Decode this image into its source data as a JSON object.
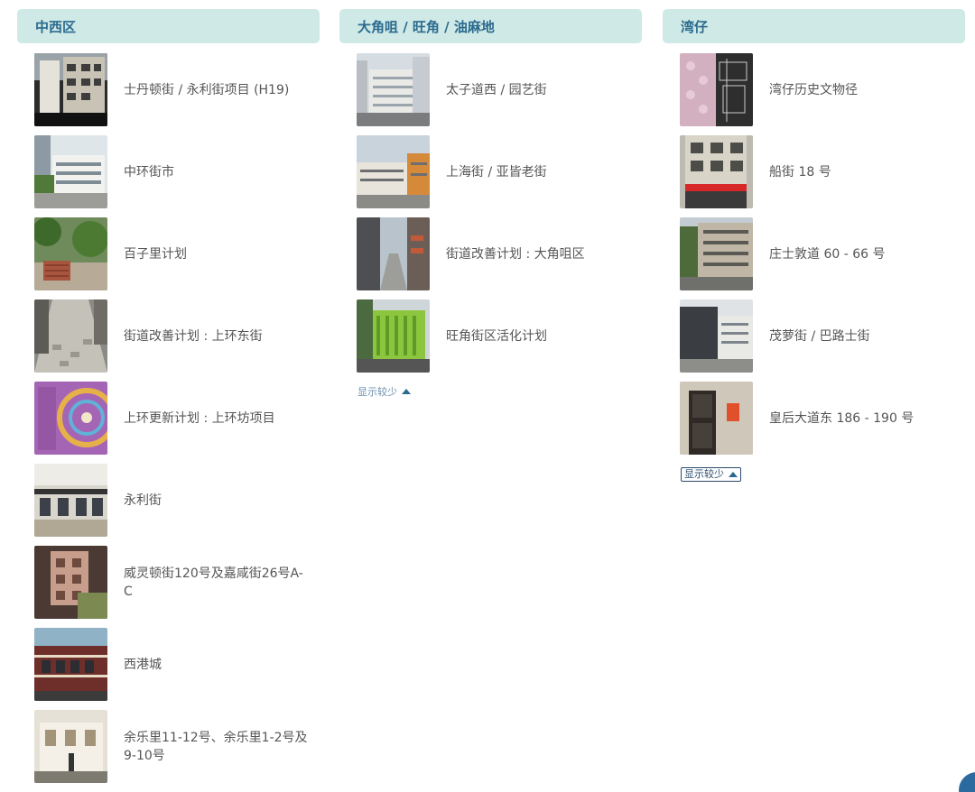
{
  "colors": {
    "header_bg": "#cfe9e6",
    "header_text": "#2a6a8e",
    "accent": "#2a6a9e"
  },
  "columns": [
    {
      "title": "中西区",
      "items": [
        {
          "label": "士丹顿街 / 永利街项目 (H19)",
          "thumb": "building-street"
        },
        {
          "label": "中环街市",
          "thumb": "market-building"
        },
        {
          "label": "百子里计划",
          "thumb": "garden-site"
        },
        {
          "label": "街道改善计划 : 上环东街",
          "thumb": "paved-lane"
        },
        {
          "label": "上环更新计划 : 上环坊项目",
          "thumb": "poster"
        },
        {
          "label": "永利街",
          "thumb": "balcony-building"
        },
        {
          "label": "威灵顿街120号及嘉咸街26号A-C",
          "thumb": "tenement"
        },
        {
          "label": "西港城",
          "thumb": "western-market"
        },
        {
          "label": "余乐里11-12号、余乐里1-2号及9-10号",
          "thumb": "shophouse"
        }
      ]
    },
    {
      "title": "大角咀 / 旺角 / 油麻地",
      "items": [
        {
          "label": "太子道西 / 园艺街",
          "thumb": "corner-building"
        },
        {
          "label": "上海街 / 亚皆老街",
          "thumb": "shophouse-row"
        },
        {
          "label": "街道改善计划 : 大角咀区",
          "thumb": "narrow-street"
        },
        {
          "label": "旺角街区活化计划",
          "thumb": "green-facade"
        }
      ],
      "show_less": "显示较少"
    },
    {
      "title": "湾仔",
      "items": [
        {
          "label": "湾仔历史文物径",
          "thumb": "pattern-poster"
        },
        {
          "label": "船街 18 号",
          "thumb": "shop-front"
        },
        {
          "label": "庄士敦道 60 - 66 号",
          "thumb": "tram-street"
        },
        {
          "label": "茂萝街 / 巴路士街",
          "thumb": "modern-block"
        },
        {
          "label": "皇后大道东 186 - 190 号",
          "thumb": "old-wall"
        }
      ],
      "show_less": "显示较少"
    }
  ]
}
